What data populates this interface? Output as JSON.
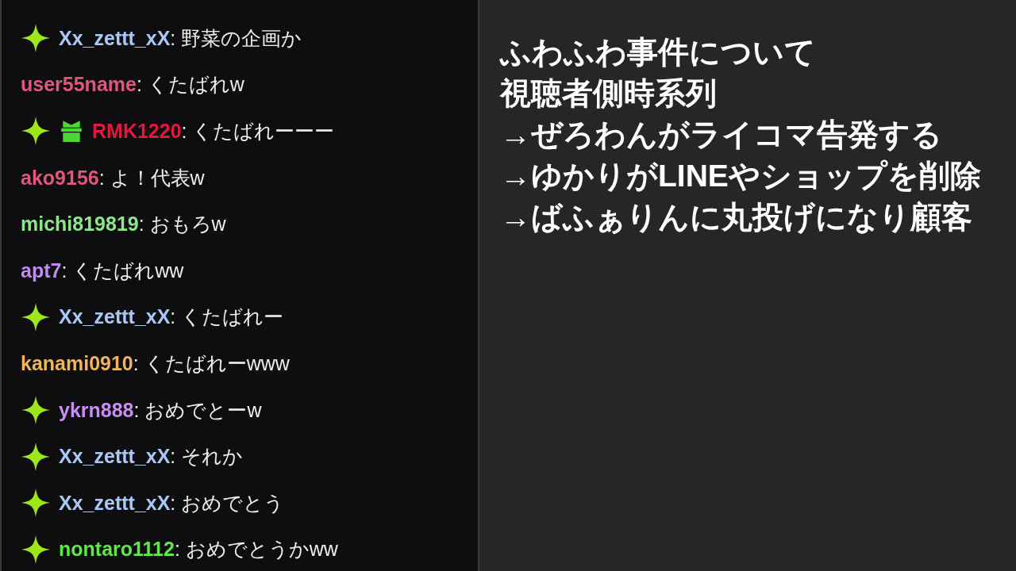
{
  "chat": {
    "messages": [
      {
        "badges": [
          {
            "kind": "sparkle"
          }
        ],
        "user": "Xx_zettt_xX",
        "color": "#a9c8f5",
        "text": ": 野菜の企画か"
      },
      {
        "user": "user55name",
        "color": "#e0577a",
        "text": ": くたばれw"
      },
      {
        "badges": [
          {
            "kind": "sparkle"
          },
          {
            "kind": "gift"
          }
        ],
        "user": "RMK1220",
        "color": "#e3173f",
        "text": ": くたばれーーー"
      },
      {
        "user": "ako9156",
        "color": "#e0577a",
        "text": ": よ！代表w"
      },
      {
        "user": "michi819819",
        "color": "#8ee68a",
        "text": ": おもろw"
      },
      {
        "user": "apt7",
        "color": "#c08cf0",
        "text": ": くたばれww"
      },
      {
        "badges": [
          {
            "kind": "sparkle"
          }
        ],
        "user": "Xx_zettt_xX",
        "color": "#a9c8f5",
        "text": ": くたばれー"
      },
      {
        "user": "kanami0910",
        "color": "#f0b45a",
        "text": ": くたばれーwww"
      },
      {
        "badges": [
          {
            "kind": "sparkle"
          }
        ],
        "user": "ykrn888",
        "color": "#c98ef2",
        "text": ": おめでとーw"
      },
      {
        "badges": [
          {
            "kind": "sparkle"
          }
        ],
        "user": "Xx_zettt_xX",
        "color": "#a9c8f5",
        "text": ": それか"
      },
      {
        "badges": [
          {
            "kind": "sparkle"
          }
        ],
        "user": "Xx_zettt_xX",
        "color": "#a9c8f5",
        "text": ": おめでとう"
      },
      {
        "badges": [
          {
            "kind": "sparkle"
          }
        ],
        "user": "nontaro1112",
        "color": "#5ee84a",
        "text": ": おめでとうかww"
      }
    ]
  },
  "notes": {
    "lines": [
      "ふわふわ事件について",
      "視聴者側時系列",
      "→ぜろわんがライコマ告発する",
      "→ゆかりがLINEやショップを削除",
      "→ばふぁりんに丸投げになり顧客"
    ]
  }
}
